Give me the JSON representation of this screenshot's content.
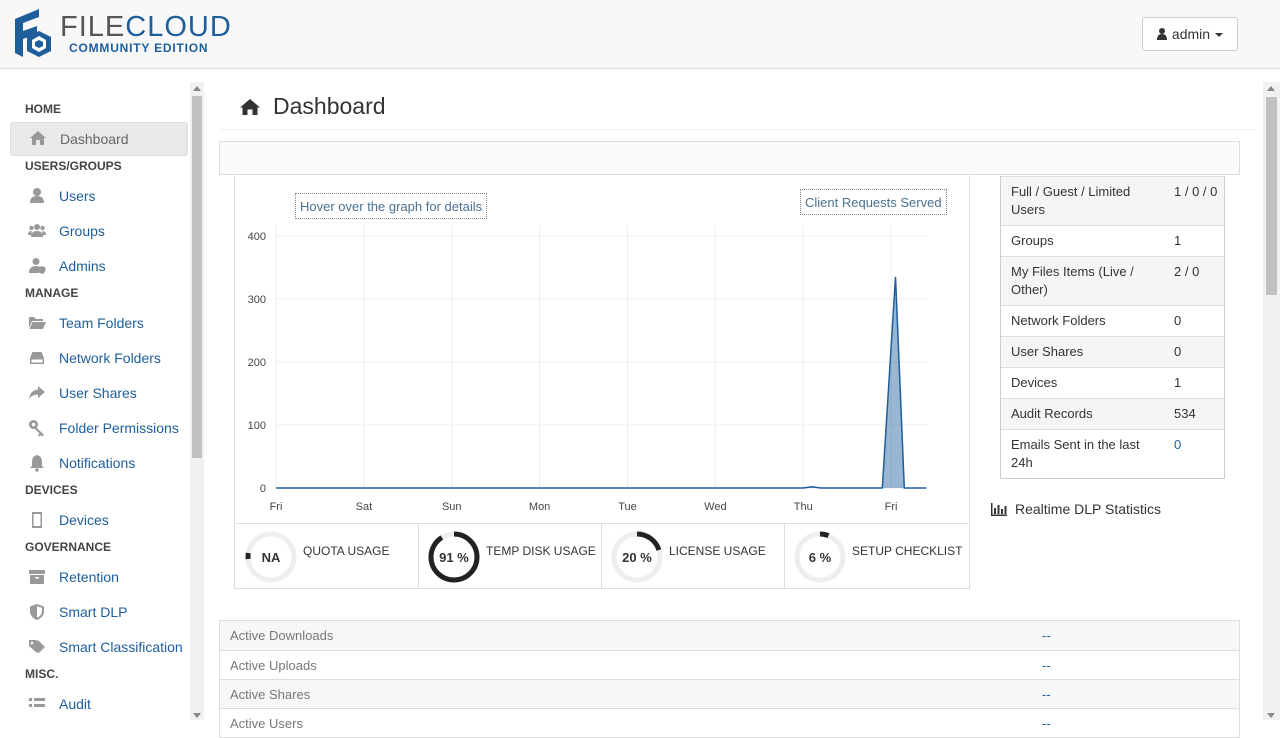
{
  "brand": {
    "name_part1": "FILE",
    "name_part2": "CLOUD",
    "edition": "COMMUNITY EDITION"
  },
  "user_menu": {
    "label": "admin",
    "icon": "user-icon"
  },
  "sidebar": {
    "sections": [
      {
        "heading": "HOME",
        "items": [
          {
            "label": "Dashboard",
            "icon": "home-icon",
            "active": true
          }
        ]
      },
      {
        "heading": "USERS/GROUPS",
        "items": [
          {
            "label": "Users",
            "icon": "user-icon"
          },
          {
            "label": "Groups",
            "icon": "users-icon"
          },
          {
            "label": "Admins",
            "icon": "user-shield-icon"
          }
        ]
      },
      {
        "heading": "MANAGE",
        "items": [
          {
            "label": "Team Folders",
            "icon": "folder-open-icon"
          },
          {
            "label": "Network Folders",
            "icon": "hdd-icon"
          },
          {
            "label": "User Shares",
            "icon": "share-icon"
          },
          {
            "label": "Folder Permissions",
            "icon": "key-icon"
          },
          {
            "label": "Notifications",
            "icon": "bell-icon"
          }
        ]
      },
      {
        "heading": "DEVICES",
        "items": [
          {
            "label": "Devices",
            "icon": "mobile-icon"
          }
        ]
      },
      {
        "heading": "GOVERNANCE",
        "items": [
          {
            "label": "Retention",
            "icon": "archive-icon"
          },
          {
            "label": "Smart DLP",
            "icon": "shield-icon"
          },
          {
            "label": "Smart Classification",
            "icon": "tags-icon"
          }
        ]
      },
      {
        "heading": "MISC.",
        "items": [
          {
            "label": "Audit",
            "icon": "list-icon"
          }
        ]
      }
    ]
  },
  "page": {
    "title": "Dashboard",
    "icon": "home-icon"
  },
  "chart": {
    "hover_note": "Hover over the graph for details",
    "series_label": "Client Requests Served"
  },
  "chart_data": {
    "type": "area",
    "x": [
      "Fri",
      "Sat",
      "Sun",
      "Mon",
      "Tue",
      "Wed",
      "Thu",
      "Fri"
    ],
    "series": [
      {
        "name": "Client Requests Served",
        "points": [
          {
            "day": 0,
            "y": 0
          },
          {
            "day": 6.0,
            "y": 0
          },
          {
            "day": 6.1,
            "y": 2
          },
          {
            "day": 6.2,
            "y": 0
          },
          {
            "day": 6.9,
            "y": 0
          },
          {
            "day": 7.05,
            "y": 335
          },
          {
            "day": 7.15,
            "y": 0
          },
          {
            "day": 7.4,
            "y": 0
          }
        ]
      }
    ],
    "yticks": [
      0,
      100,
      200,
      300,
      400
    ],
    "ylim": [
      0,
      400
    ],
    "grid": true,
    "color": "#1d5e9b"
  },
  "gauges": [
    {
      "value_text": "NA",
      "label": "QUOTA USAGE",
      "percent": 0
    },
    {
      "value_text": "91 %",
      "label": "TEMP DISK USAGE",
      "percent": 91
    },
    {
      "value_text": "20 %",
      "label": "LICENSE USAGE",
      "percent": 20
    },
    {
      "value_text": "6 %",
      "label": "SETUP CHECKLIST",
      "percent": 6
    }
  ],
  "stats": [
    {
      "key": "Full / Guest / Limited Users",
      "value": "1 / 0 / 0"
    },
    {
      "key": "Groups",
      "value": "1"
    },
    {
      "key": "My Files Items (Live / Other)",
      "value": "2 / 0"
    },
    {
      "key": "Network Folders",
      "value": "0"
    },
    {
      "key": "User Shares",
      "value": "0"
    },
    {
      "key": "Devices",
      "value": "1"
    },
    {
      "key": "Audit Records",
      "value": "534"
    },
    {
      "key": "Emails Sent in the last 24h",
      "value": "0",
      "link": true
    }
  ],
  "dlp": {
    "label": "Realtime DLP Statistics",
    "icon": "bar-chart-icon"
  },
  "activity": [
    {
      "key": "Active Downloads",
      "value": "--"
    },
    {
      "key": "Active Uploads",
      "value": "--"
    },
    {
      "key": "Active Shares",
      "value": "--"
    },
    {
      "key": "Active Users",
      "value": "--"
    }
  ]
}
